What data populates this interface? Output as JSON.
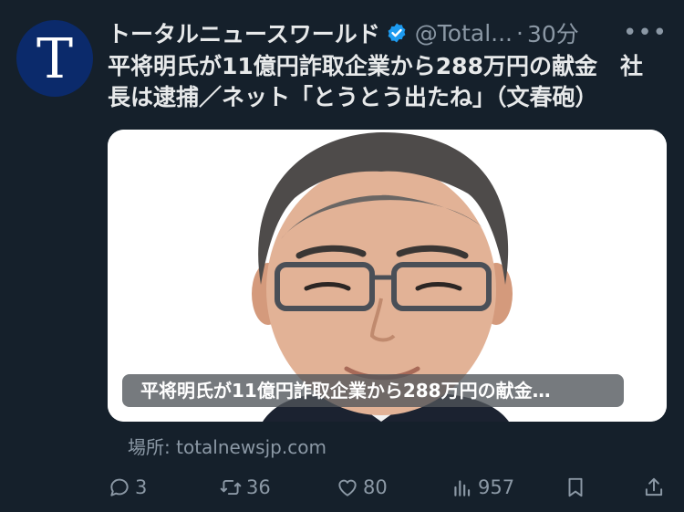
{
  "author": {
    "display_name": "トータルニュースワールド",
    "handle": "@Total...",
    "separator": "·",
    "time": "30分",
    "avatar_letter": "T",
    "avatar_color": "#0b2a6b",
    "verified_color": "#1d9bf0"
  },
  "tweet": {
    "text": "平将明氏が11億円詐取企業から288万円の献金　社長は逮捕／ネット「とうとう出たね」（文春砲）"
  },
  "card": {
    "title": "平将明氏が11億円詐取企業から288万円の献金…",
    "source_label": "場所: ",
    "source_domain": "totalnewsjp.com"
  },
  "actions": {
    "replies": "3",
    "retweets": "36",
    "likes": "80",
    "views": "957"
  },
  "icons": {
    "more": "more-icon",
    "reply": "reply-icon",
    "retweet": "retweet-icon",
    "like": "heart-icon",
    "views": "views-icon",
    "bookmark": "bookmark-icon",
    "share": "share-icon"
  },
  "colors": {
    "background": "#15202b",
    "primary_text": "#e7e9ea",
    "secondary_text": "#8b98a5"
  }
}
